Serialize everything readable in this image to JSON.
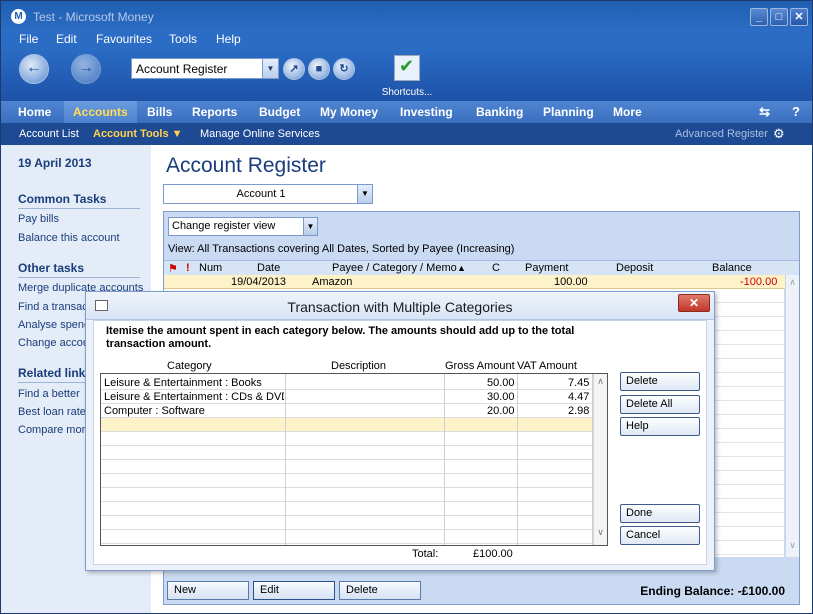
{
  "window": {
    "title": "Test - Microsoft Money",
    "app_icon": "M"
  },
  "menu": {
    "file": "File",
    "edit": "Edit",
    "favourites": "Favourites",
    "tools": "Tools",
    "help": "Help"
  },
  "toolbar": {
    "location": "Account Register",
    "shortcuts_label": "Shortcuts..."
  },
  "tabs": [
    "Home",
    "Accounts",
    "Bills",
    "Reports",
    "Budget",
    "My Money",
    "Investing",
    "Banking",
    "Planning",
    "More"
  ],
  "active_tab": "Accounts",
  "subnav": {
    "account_list": "Account List",
    "account_tools": "Account Tools",
    "manage_online": "Manage Online Services",
    "advanced_register": "Advanced Register"
  },
  "sidebar": {
    "date": "19 April 2013",
    "common_tasks_heading": "Common Tasks",
    "common_tasks": [
      "Pay bills",
      "Balance this account"
    ],
    "other_tasks_heading": "Other tasks",
    "other_tasks": [
      "Merge duplicate accounts",
      "Find a transac",
      "Analyse spend",
      "Change accou"
    ],
    "related_heading": "Related link",
    "related": [
      "Find a better",
      "Best loan rate",
      "Compare mort"
    ]
  },
  "register": {
    "title": "Account Register",
    "account": "Account 1",
    "view_combo": "Change register view",
    "view_line": "View: All Transactions covering All Dates, Sorted by Payee (Increasing)",
    "columns": {
      "num": "Num",
      "date": "Date",
      "payee": "Payee / Category / Memo",
      "c": "C",
      "payment": "Payment",
      "deposit": "Deposit",
      "balance": "Balance"
    },
    "row": {
      "date": "19/04/2013",
      "payee": "Amazon",
      "payment": "100.00",
      "balance": "-100.00"
    },
    "buttons": {
      "new": "New",
      "edit": "Edit",
      "delete": "Delete"
    },
    "ending_balance": "Ending Balance: -£100.00"
  },
  "dialog": {
    "title": "Transaction with Multiple Categories",
    "instruction": "Itemise the amount spent in each category below. The amounts should add up to the total transaction amount.",
    "columns": {
      "category": "Category",
      "description": "Description",
      "gross": "Gross Amount",
      "vat": "VAT Amount"
    },
    "rows": [
      {
        "category": "Leisure & Entertainment : Books",
        "description": "",
        "gross": "50.00",
        "vat": "7.45"
      },
      {
        "category": "Leisure & Entertainment : CDs & DVDs",
        "description": "",
        "gross": "30.00",
        "vat": "4.47"
      },
      {
        "category": "Computer : Software",
        "description": "",
        "gross": "20.00",
        "vat": "2.98"
      }
    ],
    "total_label": "Total:",
    "total_value": "£100.00",
    "buttons": {
      "delete": "Delete",
      "delete_all": "Delete All",
      "help": "Help",
      "done": "Done",
      "cancel": "Cancel"
    }
  }
}
